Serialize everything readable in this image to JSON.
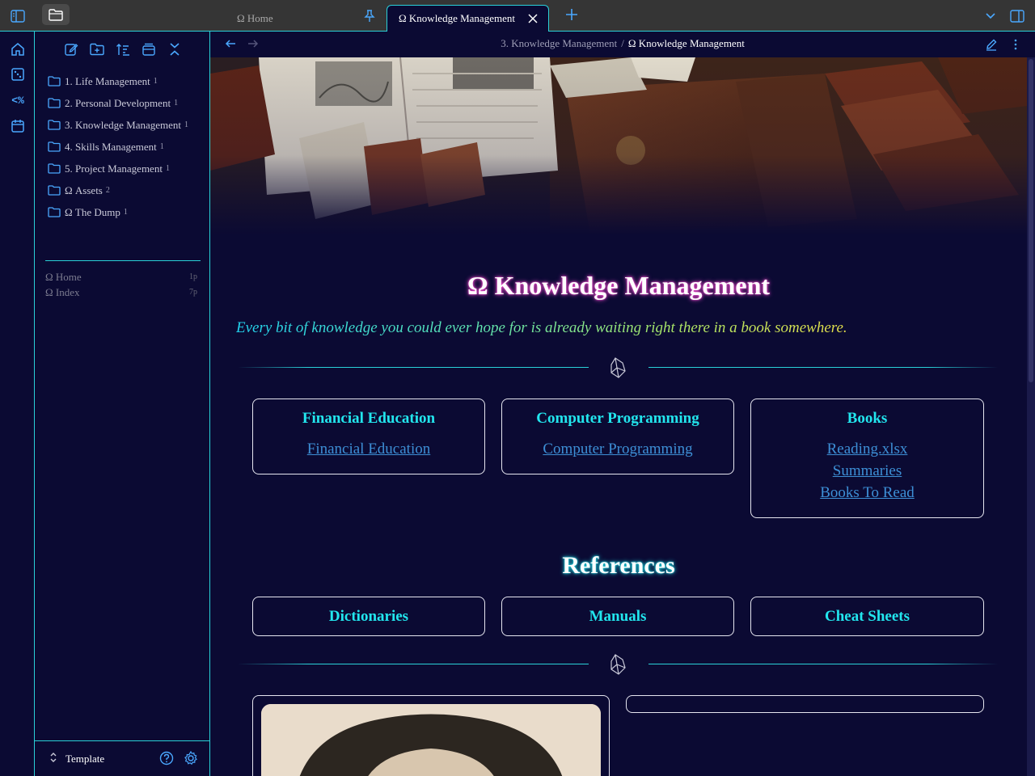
{
  "colors": {
    "background": "#0b0a33",
    "accent": "#2ad1d8",
    "heading_cyan": "#22e6ee",
    "link_blue": "#3d8fd6",
    "title_glow": "#ff4fd8",
    "topbar": "#353535"
  },
  "tabs": [
    {
      "label": "Ω Home",
      "pinned": true,
      "active": false
    },
    {
      "label": "Ω Knowledge Management",
      "active": true
    }
  ],
  "ribbon": {
    "icons": [
      "home-icon",
      "dice-icon",
      "templater-icon",
      "calendar-icon"
    ],
    "templater_text": "<%"
  },
  "explorer": {
    "toolbar": [
      "new-note-icon",
      "new-folder-icon",
      "sort-icon",
      "collapse-window-icon",
      "collapse-all-icon"
    ],
    "folders": [
      {
        "label": "1. Life Management",
        "count": "1"
      },
      {
        "label": "2. Personal Development",
        "count": "1"
      },
      {
        "label": "3. Knowledge Management",
        "count": "1"
      },
      {
        "label": "4. Skills Management",
        "count": "1"
      },
      {
        "label": "5. Project Management",
        "count": "1"
      },
      {
        "label": "Ω Assets",
        "count": "2"
      },
      {
        "label": "Ω The Dump",
        "count": "1"
      }
    ],
    "pinned": [
      {
        "label": "Ω Home",
        "pages": "1p"
      },
      {
        "label": "Ω Index",
        "pages": "7p"
      }
    ],
    "vault_name": "Template"
  },
  "breadcrumb": {
    "parent": "3. Knowledge Management",
    "separator": "/",
    "current": "Ω Knowledge Management"
  },
  "page": {
    "title": "Ω Knowledge Management",
    "quote": "Every bit of knowledge you could ever hope for is already waiting right there in a book somewhere.",
    "cards": [
      {
        "title": "Financial Education",
        "links": [
          "Financial Education"
        ]
      },
      {
        "title": "Computer Programming",
        "links": [
          "Computer Programming"
        ]
      },
      {
        "title": "Books",
        "links": [
          "Reading.xlsx",
          "Summaries",
          "Books To Read"
        ]
      }
    ],
    "references_title": "References",
    "references": [
      "Dictionaries",
      "Manuals",
      "Cheat Sheets"
    ]
  }
}
